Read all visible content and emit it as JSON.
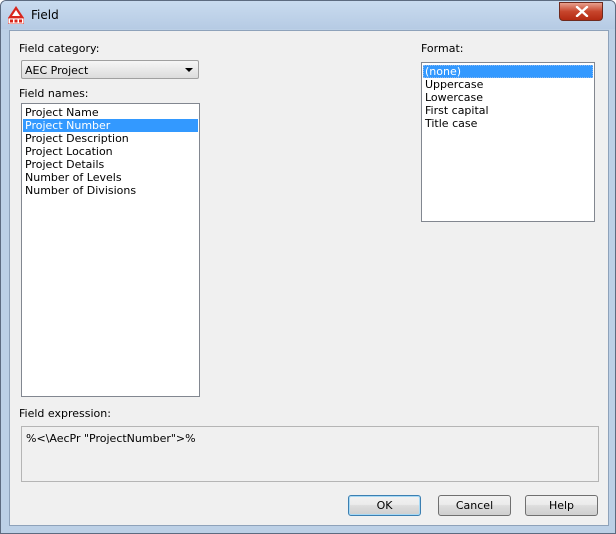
{
  "window": {
    "title": "Field"
  },
  "field_category": {
    "label": "Field category:",
    "value": "AEC Project"
  },
  "field_names": {
    "label": "Field names:",
    "items": [
      {
        "label": "Project Name",
        "selected": false
      },
      {
        "label": "Project Number",
        "selected": true
      },
      {
        "label": "Project Description",
        "selected": false
      },
      {
        "label": "Project Location",
        "selected": false
      },
      {
        "label": "Project Details",
        "selected": false
      },
      {
        "label": "Number of Levels",
        "selected": false
      },
      {
        "label": "Number of Divisions",
        "selected": false
      }
    ]
  },
  "format": {
    "label": "Format:",
    "items": [
      {
        "label": "(none)",
        "selected": true
      },
      {
        "label": "Uppercase",
        "selected": false
      },
      {
        "label": "Lowercase",
        "selected": false
      },
      {
        "label": "First capital",
        "selected": false
      },
      {
        "label": "Title case",
        "selected": false
      }
    ]
  },
  "field_expression": {
    "label": "Field expression:",
    "value": "%<\\AecPr \"ProjectNumber\">%"
  },
  "buttons": {
    "ok": "OK",
    "cancel": "Cancel",
    "help": "Help"
  },
  "colors": {
    "selection": "#3399ff",
    "title_bar": "#bcd0e6",
    "close_button": "#c7452c"
  },
  "icons": {
    "app": "autocad-mep-icon",
    "close": "close-icon",
    "dropdown": "chevron-down-icon"
  }
}
